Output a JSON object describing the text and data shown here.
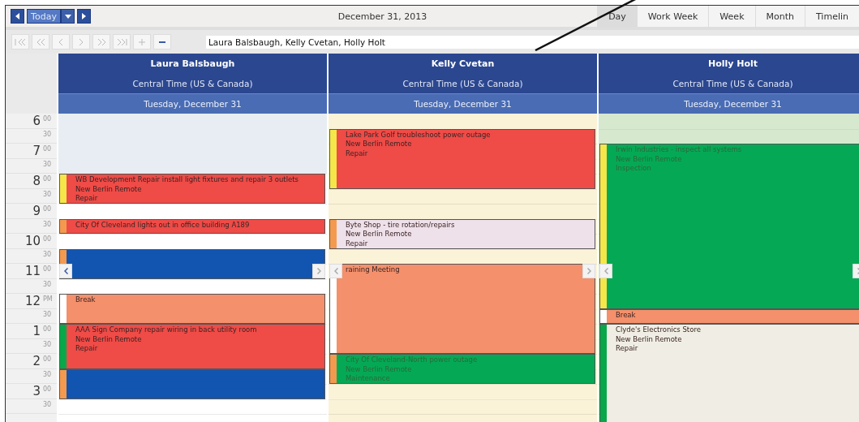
{
  "toolbar": {
    "today_label": "Today",
    "date": "December 31, 2013",
    "views": [
      {
        "label": "Day",
        "selected": true
      },
      {
        "label": "Work Week",
        "selected": false
      },
      {
        "label": "Week",
        "selected": false
      },
      {
        "label": "Month",
        "selected": false
      },
      {
        "label": "Timelin",
        "selected": false
      }
    ]
  },
  "resource_filter": {
    "value": "Laura Balsbaugh, Kelly Cvetan, Holly Holt"
  },
  "time_slots": [
    {
      "hour": "6",
      "minute": "00"
    },
    {
      "minute": "30"
    },
    {
      "hour": "7",
      "minute": "00"
    },
    {
      "minute": "30"
    },
    {
      "hour": "8",
      "minute": "00"
    },
    {
      "minute": "30"
    },
    {
      "hour": "9",
      "minute": "00"
    },
    {
      "minute": "30"
    },
    {
      "hour": "10",
      "minute": "00"
    },
    {
      "minute": "30"
    },
    {
      "hour": "11",
      "minute": "00"
    },
    {
      "minute": "30"
    },
    {
      "hour": "12",
      "minute": "PM"
    },
    {
      "minute": "30"
    },
    {
      "hour": "1",
      "minute": "00"
    },
    {
      "minute": "30"
    },
    {
      "hour": "2",
      "minute": "00"
    },
    {
      "minute": "30"
    },
    {
      "hour": "3",
      "minute": "00"
    },
    {
      "minute": "30"
    }
  ],
  "resources": [
    {
      "name": "Laura Balsbaugh",
      "timezone": "Central Time (US & Canada)",
      "date": "Tuesday, December 31",
      "color": "#ffffff",
      "slots": [
        {
          "kind": "off"
        },
        {
          "kind": "off"
        },
        {
          "kind": "off"
        },
        {
          "kind": "off"
        },
        {
          "kind": "appointment",
          "color": "#ef4b47",
          "status": {
            "color": "#f5e64a"
          },
          "title": "WB Development Repair install light fixtures and repair 3 outlets",
          "lines": [
            "New Berlin Remote",
            "Repair"
          ]
        },
        {
          "kind": "continued"
        },
        {
          "kind": "open"
        },
        {
          "kind": "appointment",
          "color": "#ef4b47",
          "status": {
            "color": "#f39a4f"
          },
          "title": "City Of Cleveland lights out in office building A189"
        },
        {
          "kind": "open"
        },
        {
          "kind": "appointment",
          "color": "#1155b0",
          "status": {
            "color": "#f39a4f"
          }
        },
        {
          "kind": "continued"
        },
        {
          "kind": "open"
        },
        {
          "kind": "appointment",
          "color": "#f4906b",
          "status": {
            "color": "#ffffff"
          },
          "title": "Break"
        },
        {
          "kind": "continued"
        },
        {
          "kind": "appointment",
          "color": "#ef4b47",
          "status": {
            "color": "#07a84a"
          },
          "title": "AAA Sign Company repair wiring in back utility room",
          "lines": [
            "New Berlin Remote",
            "Repair"
          ]
        },
        {
          "kind": "continued"
        },
        {
          "kind": "continued"
        },
        {
          "kind": "appointment",
          "color": "#1155b0",
          "status": {
            "color": "#f39a4f"
          }
        },
        {
          "kind": "continued"
        },
        {
          "kind": "open"
        },
        {
          "kind": "open"
        }
      ]
    },
    {
      "name": "Kelly Cvetan",
      "timezone": "Central Time (US & Canada)",
      "date": "Tuesday, December 31",
      "color": "#fbf3d8",
      "slots": [
        {
          "kind": "open"
        },
        {
          "kind": "appointment",
          "color": "#ef4b47",
          "status": {
            "color": "#f5e64a"
          },
          "title": "Lake Park Golf troubleshoot power outage",
          "lines": [
            "New Berlin Remote",
            "Repair"
          ]
        },
        {
          "kind": "continued"
        },
        {
          "kind": "continued"
        },
        {
          "kind": "continued"
        },
        {
          "kind": "open"
        },
        {
          "kind": "open"
        },
        {
          "kind": "appointment",
          "color": "#efe1ea",
          "status": {
            "color": "#f39a4f"
          },
          "title": "Byte Shop - tire rotation/repairs",
          "lines": [
            "New Berlin Remote",
            "Repair"
          ]
        },
        {
          "kind": "continued"
        },
        {
          "kind": "open"
        },
        {
          "kind": "appointment",
          "color": "#f4906b",
          "status": {
            "color": "#ffffff"
          },
          "title": "raining Meeting"
        },
        {
          "kind": "continued"
        },
        {
          "kind": "continued"
        },
        {
          "kind": "continued"
        },
        {
          "kind": "continued"
        },
        {
          "kind": "continued"
        },
        {
          "kind": "appointment",
          "color": "#05a955",
          "status": {
            "color": "#f39a4f"
          },
          "title": "City Of Cleveland-North power outage",
          "lines": [
            "New Berlin Remote",
            "Maintenance"
          ]
        },
        {
          "kind": "continued"
        },
        {
          "kind": "open"
        },
        {
          "kind": "open"
        },
        {
          "kind": "open"
        }
      ]
    },
    {
      "name": "Holly Holt",
      "timezone": "Central Time (US & Canada)",
      "date": "Tuesday, December 31",
      "color": "#d6e9cf",
      "slots": [
        {
          "kind": "open"
        },
        {
          "kind": "open"
        },
        {
          "kind": "appointment",
          "color": "#05a955",
          "status": {
            "color": "#f5e64a"
          },
          "title": "Irwin Industries - inspect all systems",
          "lines": [
            "New Berlin Remote",
            "Inspection"
          ]
        },
        {
          "kind": "continued"
        },
        {
          "kind": "continued"
        },
        {
          "kind": "continued"
        },
        {
          "kind": "continued"
        },
        {
          "kind": "continued"
        },
        {
          "kind": "continued"
        },
        {
          "kind": "continued"
        },
        {
          "kind": "continued"
        },
        {
          "kind": "continued"
        },
        {
          "kind": "continued"
        },
        {
          "kind": "appointment",
          "color": "#f4906b",
          "status": {
            "color": "#ffffff"
          },
          "title": "Break"
        },
        {
          "kind": "appointment",
          "color": "#f0eee4",
          "status": {
            "color": "#07a84a"
          },
          "title": "Clyde's Electronics Store",
          "lines": [
            "New Berlin Remote",
            "Repair"
          ]
        },
        {
          "kind": "continued"
        },
        {
          "kind": "continued"
        },
        {
          "kind": "continued"
        },
        {
          "kind": "continued"
        },
        {
          "kind": "continued"
        },
        {
          "kind": "continued"
        },
        {
          "kind": "continued"
        }
      ]
    }
  ]
}
